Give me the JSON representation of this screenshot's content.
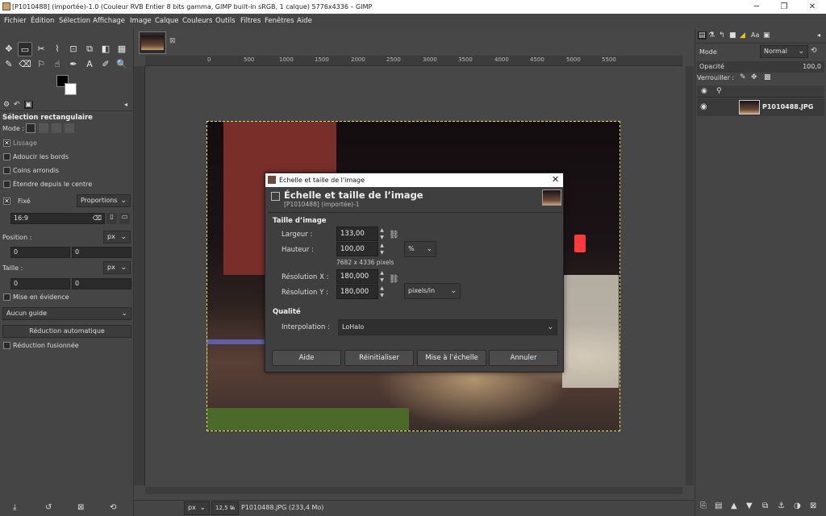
{
  "window": {
    "title": "[P1010488] (importée)-1.0 (Couleur RVB Entier 8 bits gamma, GIMP built-in sRGB, 1 calque) 5776x4336 – GIMP",
    "minimize_glyph": "─",
    "maximize_glyph": "❐",
    "close_glyph": "✕"
  },
  "menubar": [
    "Fichier",
    "Édition",
    "Sélection",
    "Affichage",
    "Image",
    "Calque",
    "Couleurs",
    "Outils",
    "Filtres",
    "Fenêtres",
    "Aide"
  ],
  "toolbox": {
    "icons": [
      "move-icon",
      "rect-select-icon",
      "fuzzy-select-icon",
      "warp-icon",
      "crop-icon",
      "unified-transform-icon",
      "paintbucket-icon",
      "blend-icon",
      "paintbrush-icon",
      "eraser-icon",
      "clone-icon",
      "smudge-icon",
      "path-icon",
      "text-icon",
      "color-picker-icon",
      "zoom-icon"
    ],
    "glyphs": [
      "✥",
      "▭",
      "✂",
      "⌇",
      "⊡",
      "⧉",
      "◧",
      "▦",
      "✎",
      "⌫",
      "⚐",
      "☝",
      "✒",
      "A",
      "✐",
      "🔍"
    ]
  },
  "tool_options": {
    "title": "Sélection rectangulaire",
    "mode_label": "Mode :",
    "smoothing": "Lissage",
    "feather": "Adoucir les bords",
    "rounded": "Coins arrondis",
    "expand_center": "Étendre depuis le centre",
    "fixed": "Fixé",
    "fixed_value": "Proportions",
    "ratio_value": "16:9",
    "position_label": "Position :",
    "position_unit": "px",
    "position_x": "0",
    "position_y": "0",
    "size_label": "Taille :",
    "size_unit": "px",
    "size_w": "0",
    "size_h": "0",
    "highlight": "Mise en évidence",
    "guides": "Aucun guide",
    "auto_shrink": "Réduction automatique",
    "shrink_merged": "Réduction fusionnée"
  },
  "ruler_ticks": [
    "0",
    "500",
    "1000",
    "1500",
    "2000",
    "2500",
    "3000",
    "3500",
    "4000",
    "4500",
    "5000",
    "5500"
  ],
  "dialog": {
    "window_title": "Échelle et taille de l'image",
    "heading": "Échelle et taille de l’image",
    "subheading": "[P1010488] (importée)-1",
    "section_size": "Taille d’image",
    "width_label": "Largeur :",
    "width_value": "133,00",
    "height_label": "Hauteur :",
    "height_value": "100,00",
    "unit": "%",
    "pixel_info": "7682 x 4336 pixels",
    "resx_label": "Résolution X :",
    "resx_value": "180,000",
    "resy_label": "Résolution Y :",
    "resy_value": "180,000",
    "res_unit": "pixels/in",
    "section_quality": "Qualité",
    "interp_label": "Interpolation :",
    "interp_value": "LoHalo",
    "btn_help": "Aide",
    "btn_reset": "Réinitialiser",
    "btn_scale": "Mise à l’échelle",
    "btn_cancel": "Annuler"
  },
  "layers": {
    "mode_label": "Mode",
    "mode_value": "Normal",
    "opacity_label": "Opacité",
    "opacity_value": "100,0",
    "lock_label": "Verrouiller :",
    "layer_name": "P1010488.JPG"
  },
  "status": {
    "unit": "px",
    "zoom": "12,5 %",
    "file_info": "P1010488.JPG (233,4 Mo)"
  }
}
